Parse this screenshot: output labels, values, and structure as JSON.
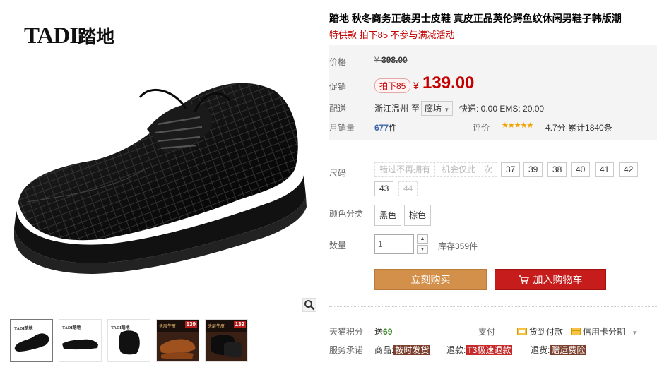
{
  "brand": {
    "en": "TADI",
    "cn": "踏地"
  },
  "thumbnails": [
    {
      "kind": "shoe-front",
      "logo": "TADI踏地",
      "active": true
    },
    {
      "kind": "shoe-side",
      "logo": "TADI踏地",
      "active": false
    },
    {
      "kind": "shoe-back",
      "logo": "TADI踏地",
      "active": false
    },
    {
      "kind": "promo",
      "tag": "头层牛皮",
      "num": "139",
      "active": false
    },
    {
      "kind": "promo",
      "tag": "头层牛皮",
      "num": "139",
      "active": false
    }
  ],
  "product": {
    "title": "踏地 秋冬商务正装男士皮鞋 真皮正品英伦鳄鱼纹休闲男鞋子韩版潮",
    "subtitle": "特供款 拍下85 不参与满减活动"
  },
  "price": {
    "label": "价格",
    "currency": "¥",
    "original": "398.00",
    "promo_label": "促销",
    "promo_tag": "拍下85",
    "promo_price": "139.00"
  },
  "shipping": {
    "label": "配送",
    "from": "浙江温州",
    "to_word": "至",
    "city": "廊坊",
    "fees": "快递: 0.00 EMS: 20.00"
  },
  "sales": {
    "label": "月销量",
    "count": "677",
    "unit": "件",
    "rating_label": "评价",
    "stars": "★★★★★",
    "score": "4.7分",
    "accum": "累计1840条"
  },
  "size": {
    "label": "尺码",
    "options": [
      {
        "text": "错过不再拥有",
        "disabled": true
      },
      {
        "text": "机会仅此一次",
        "disabled": true
      },
      {
        "text": "37",
        "disabled": false
      },
      {
        "text": "39",
        "disabled": false
      },
      {
        "text": "38",
        "disabled": false
      },
      {
        "text": "40",
        "disabled": false
      },
      {
        "text": "41",
        "disabled": false
      },
      {
        "text": "42",
        "disabled": false
      },
      {
        "text": "43",
        "disabled": false
      },
      {
        "text": "44",
        "disabled": true
      }
    ]
  },
  "color": {
    "label": "颜色分类",
    "options": [
      "黑色",
      "棕色"
    ]
  },
  "quantity": {
    "label": "数量",
    "value": "1",
    "stock": "库存359件"
  },
  "buttons": {
    "buy": "立刻购买",
    "cart": "加入购物车"
  },
  "points": {
    "label": "天猫积分",
    "prefix": "送",
    "value": "69"
  },
  "payment": {
    "label": "支付",
    "cod": "货到付款",
    "credit": "信用卡分期"
  },
  "service": {
    "label": "服务承诺",
    "goods_prefix": "商品:",
    "goods_tag": "按时发货",
    "return1_prefix": "退款:",
    "return1_tag": "T3极速退款",
    "return2_prefix": "退货:",
    "return2_tag": "赠运费险"
  },
  "colors": {
    "accent_red": "#c40000",
    "buy_button": "#d3904b",
    "cart_button": "#c71c1c"
  }
}
